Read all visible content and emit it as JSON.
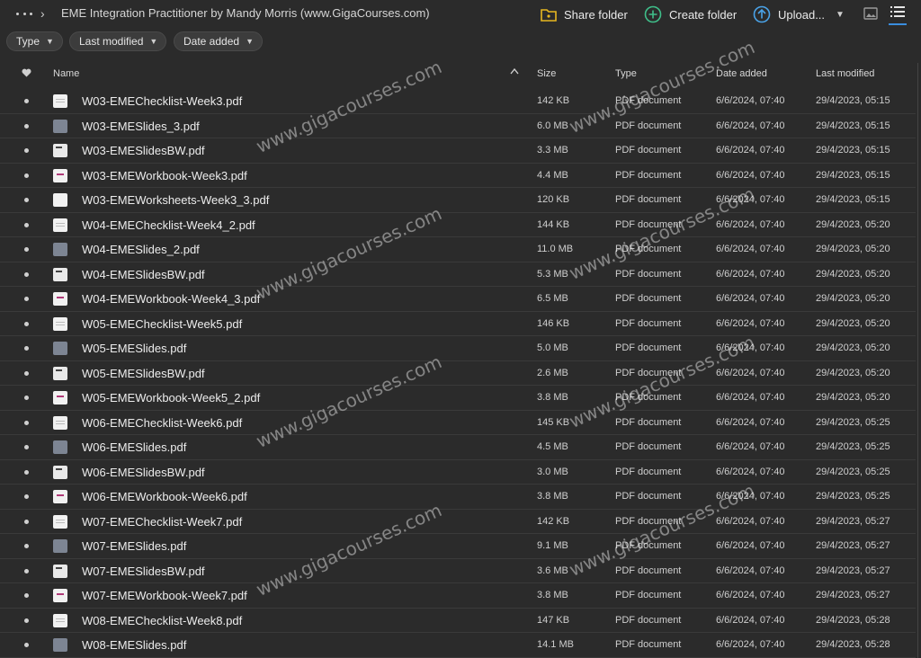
{
  "header": {
    "breadcrumb_sep": "›",
    "title": "EME Integration Practitioner by Mandy Morris (www.GigaCourses.com)",
    "share_label": "Share folder",
    "create_label": "Create folder",
    "upload_label": "Upload...",
    "accent": "#3a8dde"
  },
  "filters": {
    "type_label": "Type",
    "last_modified_label": "Last modified",
    "date_added_label": "Date added"
  },
  "table": {
    "columns": {
      "name": "Name",
      "size": "Size",
      "type": "Type",
      "date_added": "Date added",
      "last_modified": "Last modified"
    },
    "rows": [
      {
        "name": "W03-EMEChecklist-Week3.pdf",
        "size": "142 KB",
        "type": "PDF document",
        "added": "6/6/2024, 07:40",
        "modified": "29/4/2023, 05:15",
        "thumb": "checklist"
      },
      {
        "name": "W03-EMESlides_3.pdf",
        "size": "6.0 MB",
        "type": "PDF document",
        "added": "6/6/2024, 07:40",
        "modified": "29/4/2023, 05:15",
        "thumb": "slide"
      },
      {
        "name": "W03-EMESlidesBW.pdf",
        "size": "3.3 MB",
        "type": "PDF document",
        "added": "6/6/2024, 07:40",
        "modified": "29/4/2023, 05:15",
        "thumb": "bw"
      },
      {
        "name": "W03-EMEWorkbook-Week3.pdf",
        "size": "4.4 MB",
        "type": "PDF document",
        "added": "6/6/2024, 07:40",
        "modified": "29/4/2023, 05:15",
        "thumb": "workbook"
      },
      {
        "name": "W03-EMEWorksheets-Week3_3.pdf",
        "size": "120 KB",
        "type": "PDF document",
        "added": "6/6/2024, 07:40",
        "modified": "29/4/2023, 05:15",
        "thumb": "plain"
      },
      {
        "name": "W04-EMEChecklist-Week4_2.pdf",
        "size": "144 KB",
        "type": "PDF document",
        "added": "6/6/2024, 07:40",
        "modified": "29/4/2023, 05:20",
        "thumb": "checklist"
      },
      {
        "name": "W04-EMESlides_2.pdf",
        "size": "11.0 MB",
        "type": "PDF document",
        "added": "6/6/2024, 07:40",
        "modified": "29/4/2023, 05:20",
        "thumb": "slide"
      },
      {
        "name": "W04-EMESlidesBW.pdf",
        "size": "5.3 MB",
        "type": "PDF document",
        "added": "6/6/2024, 07:40",
        "modified": "29/4/2023, 05:20",
        "thumb": "bw"
      },
      {
        "name": "W04-EMEWorkbook-Week4_3.pdf",
        "size": "6.5 MB",
        "type": "PDF document",
        "added": "6/6/2024, 07:40",
        "modified": "29/4/2023, 05:20",
        "thumb": "workbook"
      },
      {
        "name": "W05-EMEChecklist-Week5.pdf",
        "size": "146 KB",
        "type": "PDF document",
        "added": "6/6/2024, 07:40",
        "modified": "29/4/2023, 05:20",
        "thumb": "checklist"
      },
      {
        "name": "W05-EMESlides.pdf",
        "size": "5.0 MB",
        "type": "PDF document",
        "added": "6/6/2024, 07:40",
        "modified": "29/4/2023, 05:20",
        "thumb": "slide"
      },
      {
        "name": "W05-EMESlidesBW.pdf",
        "size": "2.6 MB",
        "type": "PDF document",
        "added": "6/6/2024, 07:40",
        "modified": "29/4/2023, 05:20",
        "thumb": "bw"
      },
      {
        "name": "W05-EMEWorkbook-Week5_2.pdf",
        "size": "3.8 MB",
        "type": "PDF document",
        "added": "6/6/2024, 07:40",
        "modified": "29/4/2023, 05:20",
        "thumb": "workbook"
      },
      {
        "name": "W06-EMEChecklist-Week6.pdf",
        "size": "145 KB",
        "type": "PDF document",
        "added": "6/6/2024, 07:40",
        "modified": "29/4/2023, 05:25",
        "thumb": "checklist"
      },
      {
        "name": "W06-EMESlides.pdf",
        "size": "4.5 MB",
        "type": "PDF document",
        "added": "6/6/2024, 07:40",
        "modified": "29/4/2023, 05:25",
        "thumb": "slide"
      },
      {
        "name": "W06-EMESlidesBW.pdf",
        "size": "3.0 MB",
        "type": "PDF document",
        "added": "6/6/2024, 07:40",
        "modified": "29/4/2023, 05:25",
        "thumb": "bw"
      },
      {
        "name": "W06-EMEWorkbook-Week6.pdf",
        "size": "3.8 MB",
        "type": "PDF document",
        "added": "6/6/2024, 07:40",
        "modified": "29/4/2023, 05:25",
        "thumb": "workbook"
      },
      {
        "name": "W07-EMEChecklist-Week7.pdf",
        "size": "142 KB",
        "type": "PDF document",
        "added": "6/6/2024, 07:40",
        "modified": "29/4/2023, 05:27",
        "thumb": "checklist"
      },
      {
        "name": "W07-EMESlides.pdf",
        "size": "9.1 MB",
        "type": "PDF document",
        "added": "6/6/2024, 07:40",
        "modified": "29/4/2023, 05:27",
        "thumb": "slide"
      },
      {
        "name": "W07-EMESlidesBW.pdf",
        "size": "3.6 MB",
        "type": "PDF document",
        "added": "6/6/2024, 07:40",
        "modified": "29/4/2023, 05:27",
        "thumb": "bw"
      },
      {
        "name": "W07-EMEWorkbook-Week7.pdf",
        "size": "3.8 MB",
        "type": "PDF document",
        "added": "6/6/2024, 07:40",
        "modified": "29/4/2023, 05:27",
        "thumb": "workbook"
      },
      {
        "name": "W08-EMEChecklist-Week8.pdf",
        "size": "147 KB",
        "type": "PDF document",
        "added": "6/6/2024, 07:40",
        "modified": "29/4/2023, 05:28",
        "thumb": "checklist"
      },
      {
        "name": "W08-EMESlides.pdf",
        "size": "14.1 MB",
        "type": "PDF document",
        "added": "6/6/2024, 07:40",
        "modified": "29/4/2023, 05:28",
        "thumb": "slide"
      }
    ]
  },
  "watermark": {
    "text": "www.gigacourses.com"
  }
}
